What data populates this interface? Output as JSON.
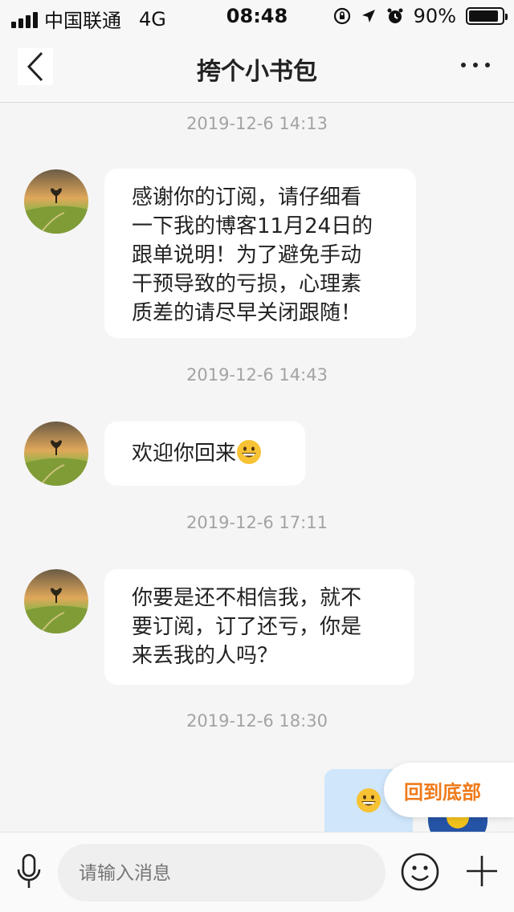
{
  "status_bar": {
    "carrier": "中国联通",
    "network": "4G",
    "time": "08:48",
    "battery": "90%",
    "battery_level": 0.9
  },
  "nav": {
    "title": "挎个小书包",
    "back_icon": "chevron-left-icon",
    "more_icon": "more-dots-icon"
  },
  "messages": [
    {
      "timestamp": "2019-12-6 14:13",
      "lines": [
        "感谢你的订阅，请仔细看",
        "一下我的博客11月24日的",
        "跟单说明！为了避免手动",
        "干预导致的亏损，心理素",
        "质差的请尽早关闭跟随！"
      ]
    },
    {
      "timestamp": "2019-12-6 14:43",
      "text": "欢迎你回来"
    },
    {
      "timestamp": "2019-12-6 17:11",
      "lines": [
        "你要是还不相信我，就不",
        "要订阅，订了还亏，你是",
        "来丢我的人吗？"
      ]
    },
    {
      "timestamp": "2019-12-6 18:30"
    }
  ],
  "back_to_bottom": "回到底部",
  "input": {
    "placeholder": "请输入消息",
    "mic_icon": "microphone-icon",
    "emoji_icon": "emoji-icon",
    "plus_icon": "plus-icon"
  },
  "colors": {
    "accent": "#ef7a1a",
    "outgoing_bubble": "#cfe6fb",
    "background": "#f5f5f5"
  }
}
